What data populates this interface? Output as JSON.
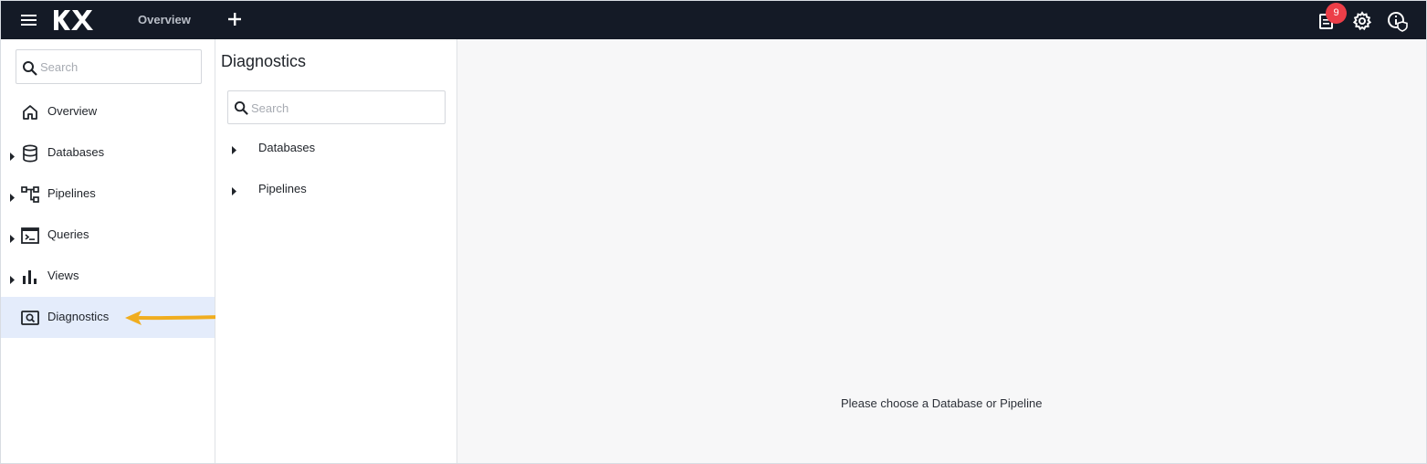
{
  "topbar": {
    "logo_text": "KX",
    "tab_label": "Overview",
    "notification_count": "9",
    "icons": [
      "menu-icon",
      "add-icon",
      "notifications-document-icon",
      "settings-gear-icon",
      "info-shield-icon"
    ]
  },
  "sidebar": {
    "search_placeholder": "Search",
    "items": [
      {
        "label": "Overview",
        "icon": "home-icon",
        "expandable": false
      },
      {
        "label": "Databases",
        "icon": "database-icon",
        "expandable": true
      },
      {
        "label": "Pipelines",
        "icon": "pipeline-icon",
        "expandable": true
      },
      {
        "label": "Queries",
        "icon": "terminal-icon",
        "expandable": true
      },
      {
        "label": "Views",
        "icon": "bar-chart-icon",
        "expandable": true
      },
      {
        "label": "Diagnostics",
        "icon": "diagnostics-icon",
        "expandable": false,
        "active": true
      }
    ]
  },
  "diagnostics_panel": {
    "title": "Diagnostics",
    "search_placeholder": "Search",
    "tree": [
      {
        "label": "Databases"
      },
      {
        "label": "Pipelines"
      }
    ]
  },
  "main": {
    "empty_message": "Please choose a Database or Pipeline"
  },
  "colors": {
    "topbar_bg": "#141a26",
    "badge": "#ec3e48",
    "active_item_bg": "#e4ecfb",
    "annotation_arrow": "#f0ad1f"
  }
}
